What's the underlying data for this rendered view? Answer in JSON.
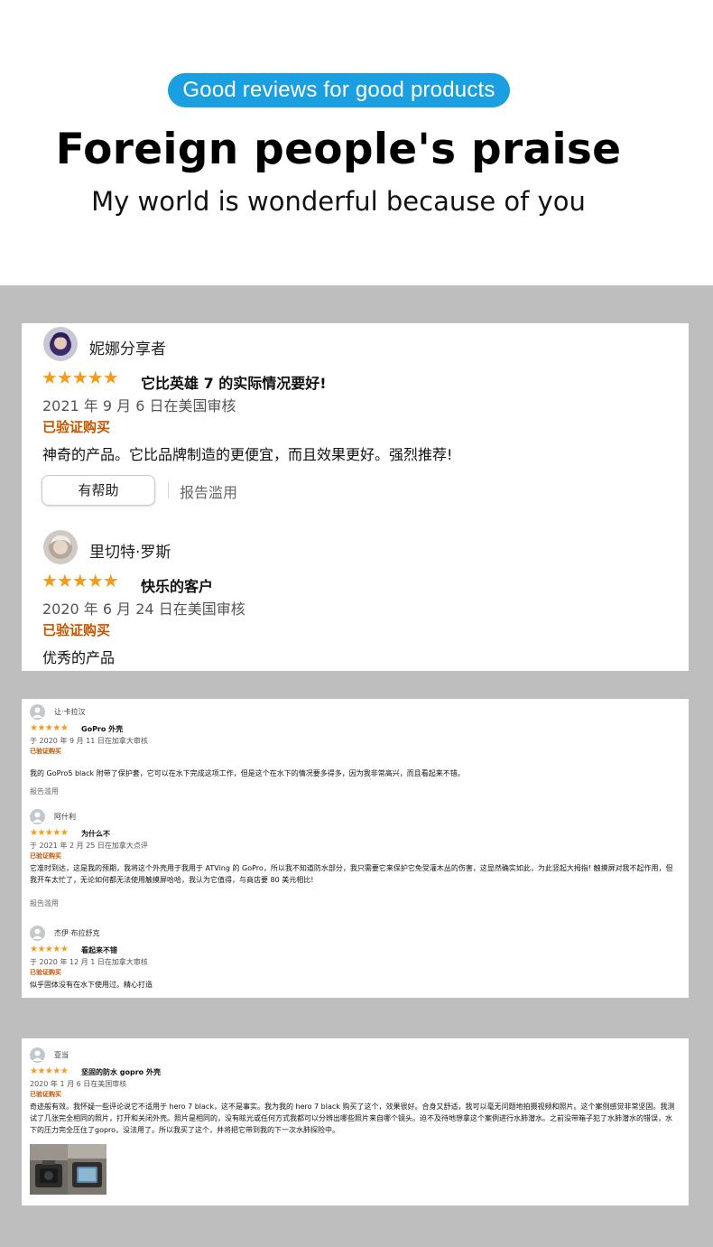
{
  "header": {
    "pill": "Good reviews for good products",
    "headline": "Foreign people's praise",
    "subline": "My world is wonderful because of you"
  },
  "card1": {
    "reviews": [
      {
        "name": "妮娜分享者",
        "stars": "★★★★★",
        "rating": 5,
        "title": "它比英雄 7 的实际情况要好!",
        "date": "2021 年 9 月 6 日在美国审核",
        "verified": "已验证购买",
        "body": "神奇的产品。它比品牌制造的更便宜，而且效果更好。强烈推荐!",
        "helpful": "有帮助",
        "report": "报告滥用"
      },
      {
        "name": "里切特·罗斯",
        "stars": "★★★★★",
        "rating": 5,
        "title": "快乐的客户",
        "date": "2020 年 6 月 24 日在美国审核",
        "verified": "已验证购买",
        "body": "优秀的产品"
      }
    ]
  },
  "card2": {
    "reviews": [
      {
        "name": "让·卡拉汉",
        "stars": "★★★★★",
        "rating": 5,
        "title": "GoPro 外壳",
        "date": "于 2020 年 9 月 11 日在加拿大审核",
        "verified": "已验证购买",
        "body": "我的 GoPro5 black 附带了保护套，它可以在水下完成这项工作，但是这个在水下的情况要多得多，因为我非常高兴，而且看起来不错。",
        "report": "报告滥用"
      },
      {
        "name": "阿什利",
        "stars": "★★★★★",
        "rating": 5,
        "title": "为什么不",
        "date": "于 2021 年 2 月 25 日在加拿大点评",
        "verified": "已验证购买",
        "body": "它准时到达，这是我的预期，我将这个外壳用于我用于 ATVing 的 GoPro，所以我不知道防水部分，我只需要它来保护它免受灌木丛的伤害，这显然确实如此，为此竖起大拇指! 触摸屏对我不起作用，但我开车太忙了，无论如何都无法使用触摸屏哈哈，我认为它值得，与商店要 80 美元相比!",
        "report": "报告滥用"
      },
      {
        "name": "杰伊·布拉舒克",
        "stars": "★★★★★",
        "rating": 5,
        "title": "看起来不错",
        "date": "于 2020 年 12 月 1 日在加拿大审核",
        "verified": "已验证购买",
        "body": "似乎固体没有在水下使用过。精心打造"
      }
    ]
  },
  "card3": {
    "reviews": [
      {
        "name": "亚当",
        "stars": "★★★★★",
        "rating": 5,
        "title": "坚固的防水 gopro 外壳",
        "date": "2020 年 1 月 6 日在美国审核",
        "verified": "已验证购买",
        "body": "奇迹般有效。我怀疑一些评论说它不适用于 hero 7 black，这不是事实。我为我的 hero 7 black 购买了这个，效果很好。合身又舒适，我可以毫无问题地拍摄视频和照片。这个案例感觉非常坚固。我测试了几张完全相同的照片，打开和关闭外壳。照片是相同的，没有眩光或任何方式我都可以分辨出哪些照片来自哪个镜头。迫不及待地想拿这个案例进行水肺潜水。之前没带箱子犯了水肺潜水的错误，水下的压力完全压住了gopro，没法用了。所以我买了这个，并将把它带到我的下一次水肺探险中。"
      }
    ]
  },
  "colors": {
    "pill": "#1a9fe0",
    "star": "#f39b1c",
    "verified": "#c45500",
    "background": "#bebebe"
  }
}
